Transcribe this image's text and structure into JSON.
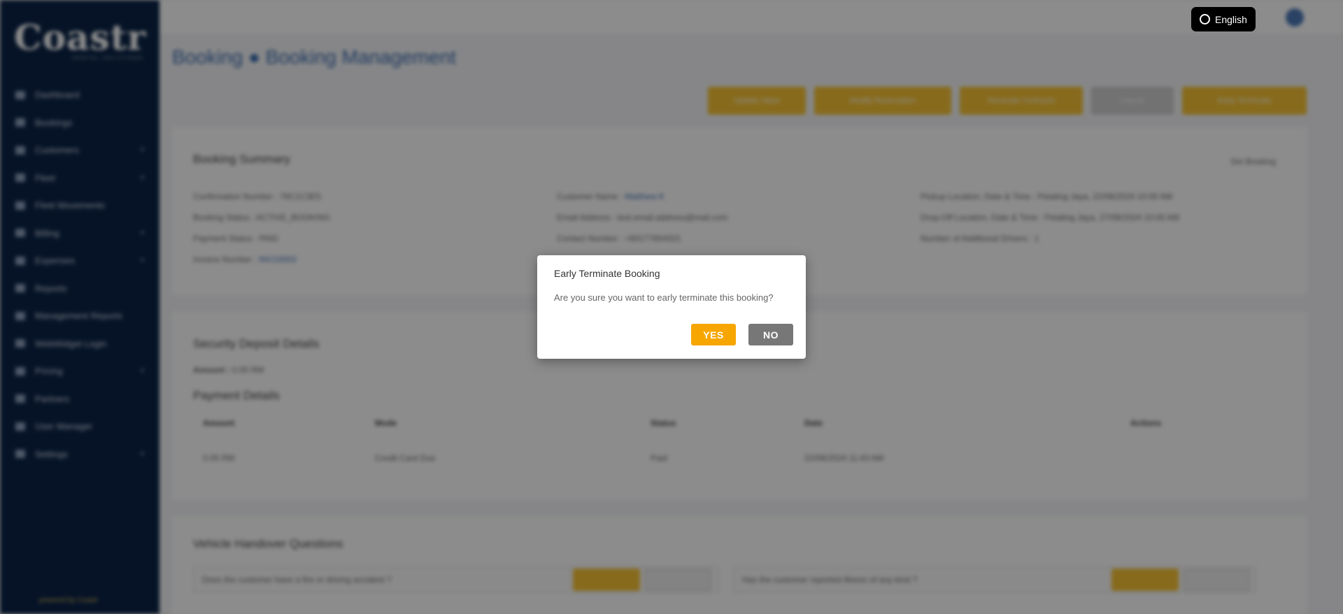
{
  "sidebar": {
    "logo": "Coastr",
    "logo_sub": "RENTAL SOLUTIONS",
    "items": [
      {
        "label": "Dashboard",
        "chev": false
      },
      {
        "label": "Bookings",
        "chev": false
      },
      {
        "label": "Customers",
        "chev": true
      },
      {
        "label": "Fleet",
        "chev": true
      },
      {
        "label": "Fleet Movements",
        "chev": false
      },
      {
        "label": "Billing",
        "chev": true
      },
      {
        "label": "Expenses",
        "chev": true
      },
      {
        "label": "Reports",
        "chev": false
      },
      {
        "label": "Management Reports",
        "chev": false
      },
      {
        "label": "WebWidget Login",
        "chev": false
      },
      {
        "label": "Pricing",
        "chev": true
      },
      {
        "label": "Partners",
        "chev": false
      },
      {
        "label": "User Manager",
        "chev": false
      },
      {
        "label": "Settings",
        "chev": true
      }
    ],
    "powered_by": "powered by Coastr"
  },
  "header": {
    "language": "English"
  },
  "page": {
    "breadcrumb": "Booking  ●  Booking Management",
    "actions": [
      "Update Value",
      "Modify Reservation",
      "Generate Contracts",
      "Cancel",
      "Early Terminate"
    ]
  },
  "summary": {
    "title": "Booking Summary",
    "edit_label": "Set Booking",
    "col1": [
      "Confirmation Number : 76C1C3E5",
      "Booking Status : ACTIVE_BOOKING",
      "Payment Status : PAID",
      "Invoice Number : "
    ],
    "invoice_link": "INV10003",
    "col2": [
      "Customer Name : ",
      "Email Address : test.email.address@mail.com",
      "Contact Number : +60177654321"
    ],
    "customer_link": "Matthew K",
    "col3": [
      "Pickup Location, Date & Time : Petaling Jaya, 22/08/2024 10:00 AM",
      "Drop-Off Location, Date & Time : Petaling Jaya, 27/08/2024 10:00 AM",
      "Number of Additional Drivers : 1"
    ]
  },
  "deposit": {
    "title": "Security Deposit Details",
    "amount_label": "Amount :",
    "amount_value": "0.00 RM",
    "payments_title": "Payment Details",
    "headers": [
      "Amount",
      "Mode",
      "Status",
      "Date",
      "Actions"
    ],
    "row": [
      "0.00 RM",
      "Credit Card Due",
      "Paid",
      "22/08/2024 11:43 AM",
      ""
    ]
  },
  "questions": {
    "title": "Vehicle Handover Questions",
    "q1": "Does the customer have a fire or driving accident ?",
    "q2": "Has the customer reported illness of any kind ?",
    "yes": "Yes",
    "no": "No"
  },
  "modal": {
    "title": "Early Terminate Booking",
    "message": "Are you sure you want to early terminate this booking?",
    "yes_label": "YES",
    "no_label": "NO"
  }
}
